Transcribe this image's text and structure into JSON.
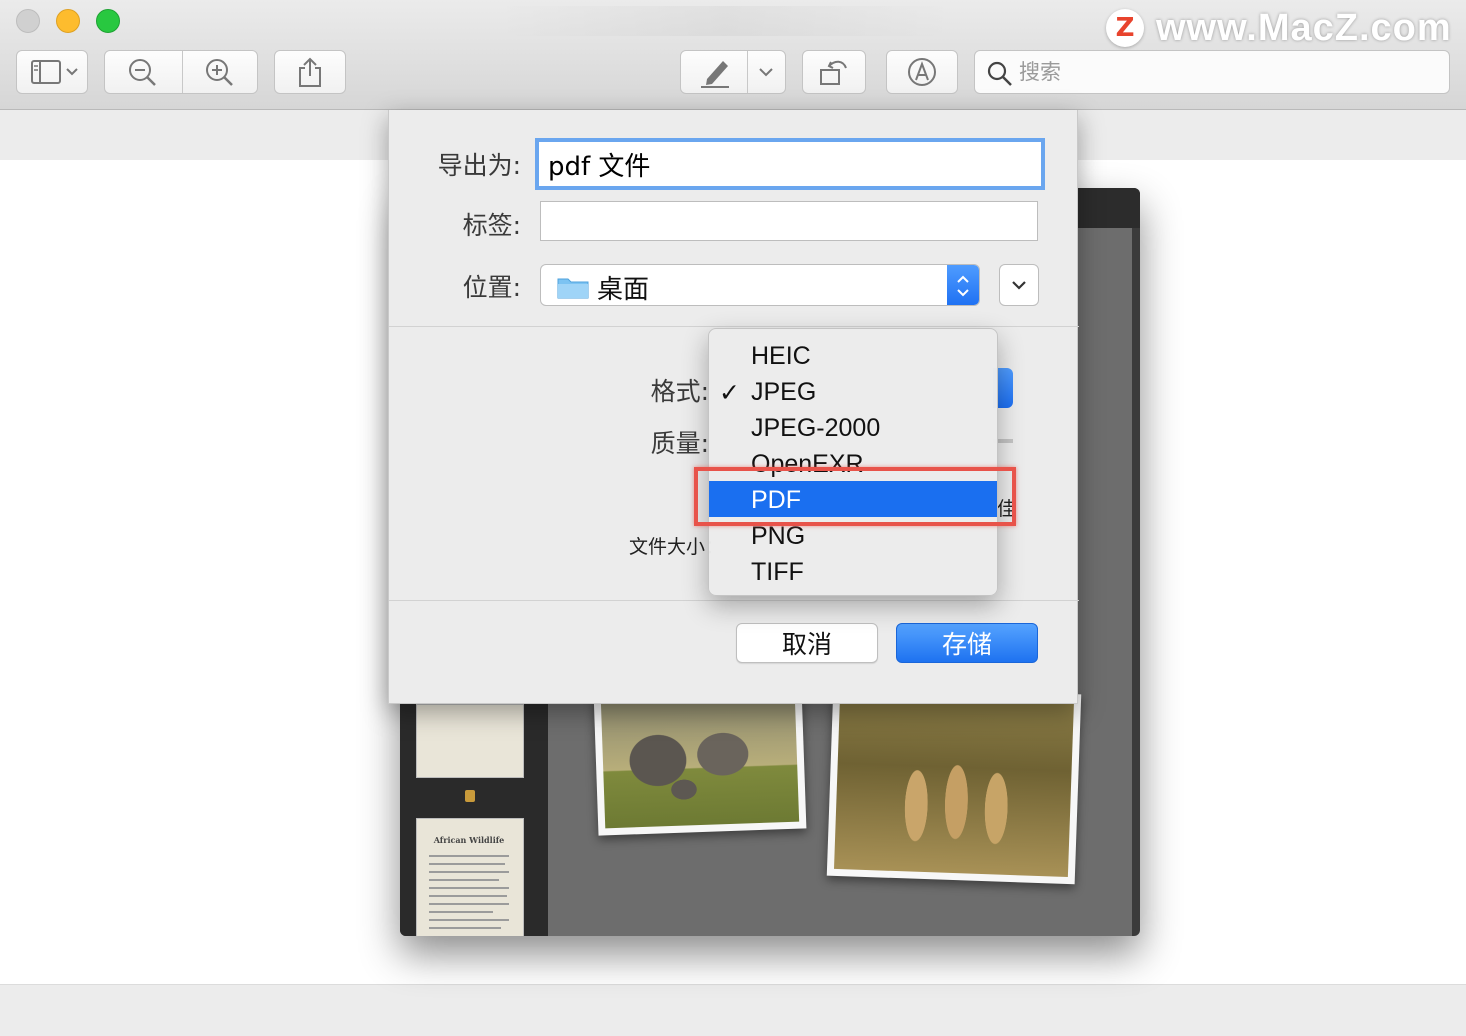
{
  "watermark": {
    "logo_letter": "Z",
    "text": "www.MacZ.com"
  },
  "toolbar": {
    "search_placeholder": "搜索",
    "icons": [
      "sidebar-icon",
      "chevron-down-icon",
      "zoom-out-icon",
      "zoom-in-icon",
      "share-icon",
      "markup-pen-icon",
      "rotate-icon",
      "annotate-icon",
      "search-icon"
    ]
  },
  "export_sheet": {
    "export_as_label": "导出为:",
    "export_as_value": "pdf 文件",
    "tags_label": "标签:",
    "tags_value": "",
    "location_label": "位置:",
    "location_value": "桌面",
    "format_label": "格式:",
    "quality_label": "质量:",
    "filesize_label": "文件大小：",
    "partial_right_text": "佳",
    "cancel_label": "取消",
    "save_label": "存储"
  },
  "format_menu": {
    "items": [
      {
        "label": "HEIC",
        "checked": false,
        "highlighted": false
      },
      {
        "label": "JPEG",
        "checked": true,
        "highlighted": false
      },
      {
        "label": "JPEG-2000",
        "checked": false,
        "highlighted": false
      },
      {
        "label": "OpenEXR",
        "checked": false,
        "highlighted": false
      },
      {
        "label": "PDF",
        "checked": false,
        "highlighted": true
      },
      {
        "label": "PNG",
        "checked": false,
        "highlighted": false
      },
      {
        "label": "TIFF",
        "checked": false,
        "highlighted": false
      }
    ],
    "check_glyph": "✓"
  },
  "background_document": {
    "thumbnail_title": "African Wildlife"
  },
  "colors": {
    "accent_blue": "#1a6ff0",
    "highlight_red": "#e8534a",
    "focus_ring": "#6aa6ef"
  }
}
